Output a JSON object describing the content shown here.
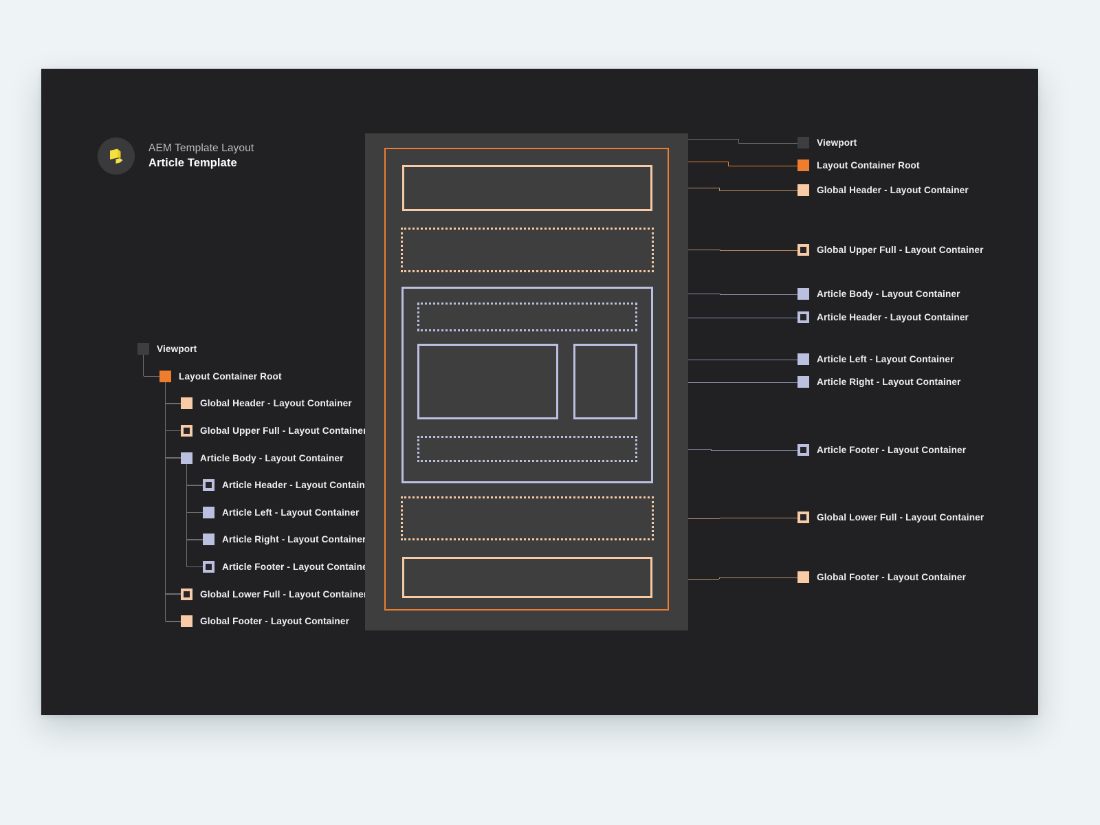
{
  "brand": {
    "logo_icon": "aem-logo-icon",
    "subtitle": "AEM Template Layout",
    "title": "Article Template"
  },
  "colors": {
    "page_background": "#eef3f5",
    "card_background": "#212123",
    "viewport_fill": "#3e3e3e",
    "viewport_swatch": "#3e3e40",
    "root_orange": "#ef7d2e",
    "peach": "#f8cba6",
    "periwinkle": "#bcc0e0",
    "connector_gray": "#6e6e72",
    "label_text": "#f0f0f2"
  },
  "tree": {
    "nodes": [
      {
        "label": "Viewport",
        "depth": 0,
        "swatch": "solid",
        "color": "#3e3e40"
      },
      {
        "label": "Layout Container Root",
        "depth": 1,
        "swatch": "solid",
        "color": "#ef7d2e"
      },
      {
        "label": "Global Header - Layout Container",
        "depth": 2,
        "swatch": "solid",
        "color": "#f8cba6"
      },
      {
        "label": "Global Upper Full - Layout Container",
        "depth": 2,
        "swatch": "hollow",
        "color": "#f8cba6"
      },
      {
        "label": "Article Body - Layout Container",
        "depth": 2,
        "swatch": "solid",
        "color": "#bcc0e0"
      },
      {
        "label": "Article Header - Layout Container",
        "depth": 3,
        "swatch": "hollow",
        "color": "#bcc0e0"
      },
      {
        "label": "Article Left - Layout Container",
        "depth": 3,
        "swatch": "solid",
        "color": "#bcc0e0"
      },
      {
        "label": "Article Right - Layout Container",
        "depth": 3,
        "swatch": "solid",
        "color": "#bcc0e0"
      },
      {
        "label": "Article Footer - Layout Container",
        "depth": 3,
        "swatch": "hollow",
        "color": "#bcc0e0"
      },
      {
        "label": "Global Lower Full - Layout Container",
        "depth": 2,
        "swatch": "hollow",
        "color": "#f8cba6"
      },
      {
        "label": "Global Footer - Layout Container",
        "depth": 2,
        "swatch": "solid",
        "color": "#f8cba6"
      }
    ]
  },
  "legend": {
    "items": [
      {
        "label": "Viewport",
        "swatch": "solid",
        "color": "#3e3e40"
      },
      {
        "label": "Layout Container Root",
        "swatch": "solid",
        "color": "#ef7d2e"
      },
      {
        "label": "Global Header - Layout Container",
        "swatch": "solid",
        "color": "#f8cba6"
      },
      {
        "label": "Global Upper Full - Layout Container",
        "swatch": "hollow",
        "color": "#f8cba6"
      },
      {
        "label": "Article Body - Layout Container",
        "swatch": "solid",
        "color": "#bcc0e0"
      },
      {
        "label": "Article Header - Layout Container",
        "swatch": "hollow",
        "color": "#bcc0e0"
      },
      {
        "label": "Article Left - Layout Container",
        "swatch": "solid",
        "color": "#bcc0e0"
      },
      {
        "label": "Article Right - Layout Container",
        "swatch": "solid",
        "color": "#bcc0e0"
      },
      {
        "label": "Article Footer - Layout Container",
        "swatch": "hollow",
        "color": "#bcc0e0"
      },
      {
        "label": "Global Lower Full - Layout Container",
        "swatch": "hollow",
        "color": "#f8cba6"
      },
      {
        "label": "Global Footer - Layout Container",
        "swatch": "solid",
        "color": "#f8cba6"
      }
    ]
  },
  "diagram": {
    "regions": [
      {
        "name": "viewport",
        "style": "fill"
      },
      {
        "name": "layout-container-root",
        "style": "solid",
        "color": "#ef7d2e"
      },
      {
        "name": "global-header",
        "style": "solid",
        "color": "#f8cba6"
      },
      {
        "name": "global-upper-full",
        "style": "dotted",
        "color": "#f8cba6"
      },
      {
        "name": "article-body",
        "style": "solid",
        "color": "#bcc0e0"
      },
      {
        "name": "article-header",
        "style": "dotted",
        "color": "#bcc0e0"
      },
      {
        "name": "article-left",
        "style": "solid",
        "color": "#bcc0e0"
      },
      {
        "name": "article-right",
        "style": "solid",
        "color": "#bcc0e0"
      },
      {
        "name": "article-footer",
        "style": "dotted",
        "color": "#bcc0e0"
      },
      {
        "name": "global-lower-full",
        "style": "dotted",
        "color": "#f8cba6"
      },
      {
        "name": "global-footer",
        "style": "solid",
        "color": "#f8cba6"
      }
    ]
  }
}
